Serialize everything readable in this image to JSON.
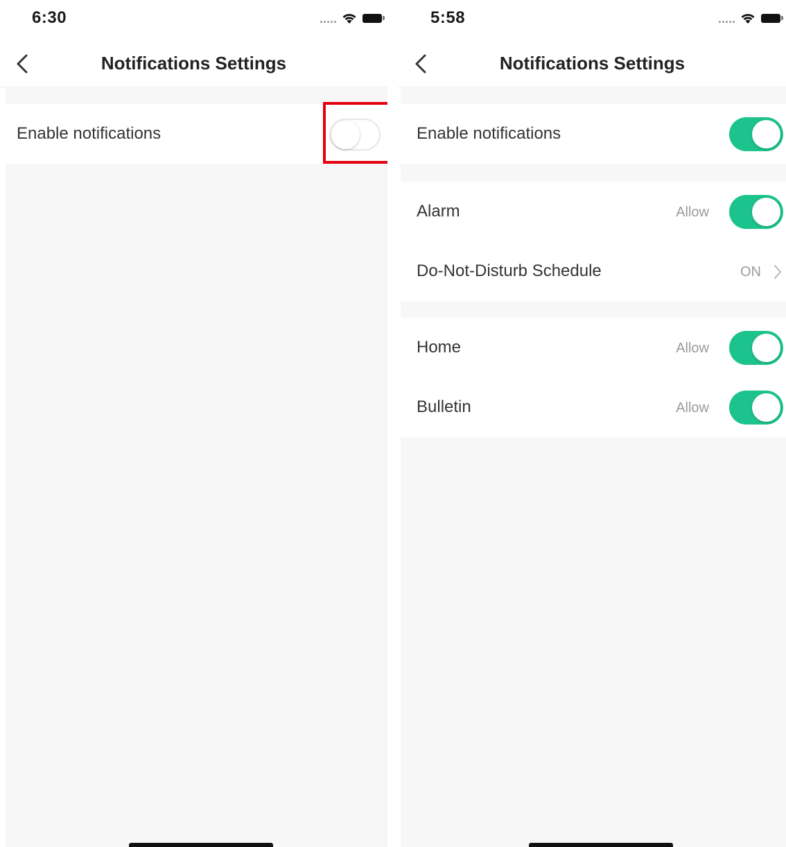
{
  "left_screen": {
    "status": {
      "time": "6:30"
    },
    "nav": {
      "title": "Notifications Settings",
      "back_icon": "chevron-left-icon"
    },
    "enable_notifications": {
      "label": "Enable notifications",
      "toggle_state": "off"
    }
  },
  "right_screen": {
    "status": {
      "time": "5:58"
    },
    "nav": {
      "title": "Notifications Settings",
      "back_icon": "chevron-left-icon"
    },
    "enable_notifications": {
      "label": "Enable notifications",
      "toggle_state": "on"
    },
    "alarm": {
      "label": "Alarm",
      "value": "Allow",
      "toggle_state": "on"
    },
    "dnd": {
      "label": "Do-Not-Disturb Schedule",
      "value": "ON"
    },
    "home": {
      "label": "Home",
      "value": "Allow",
      "toggle_state": "on"
    },
    "bulletin": {
      "label": "Bulletin",
      "value": "Allow",
      "toggle_state": "on"
    }
  },
  "colors": {
    "toggle_on": "#1cc38c",
    "highlight": "#e3000f",
    "background": "#f7f7f7"
  }
}
